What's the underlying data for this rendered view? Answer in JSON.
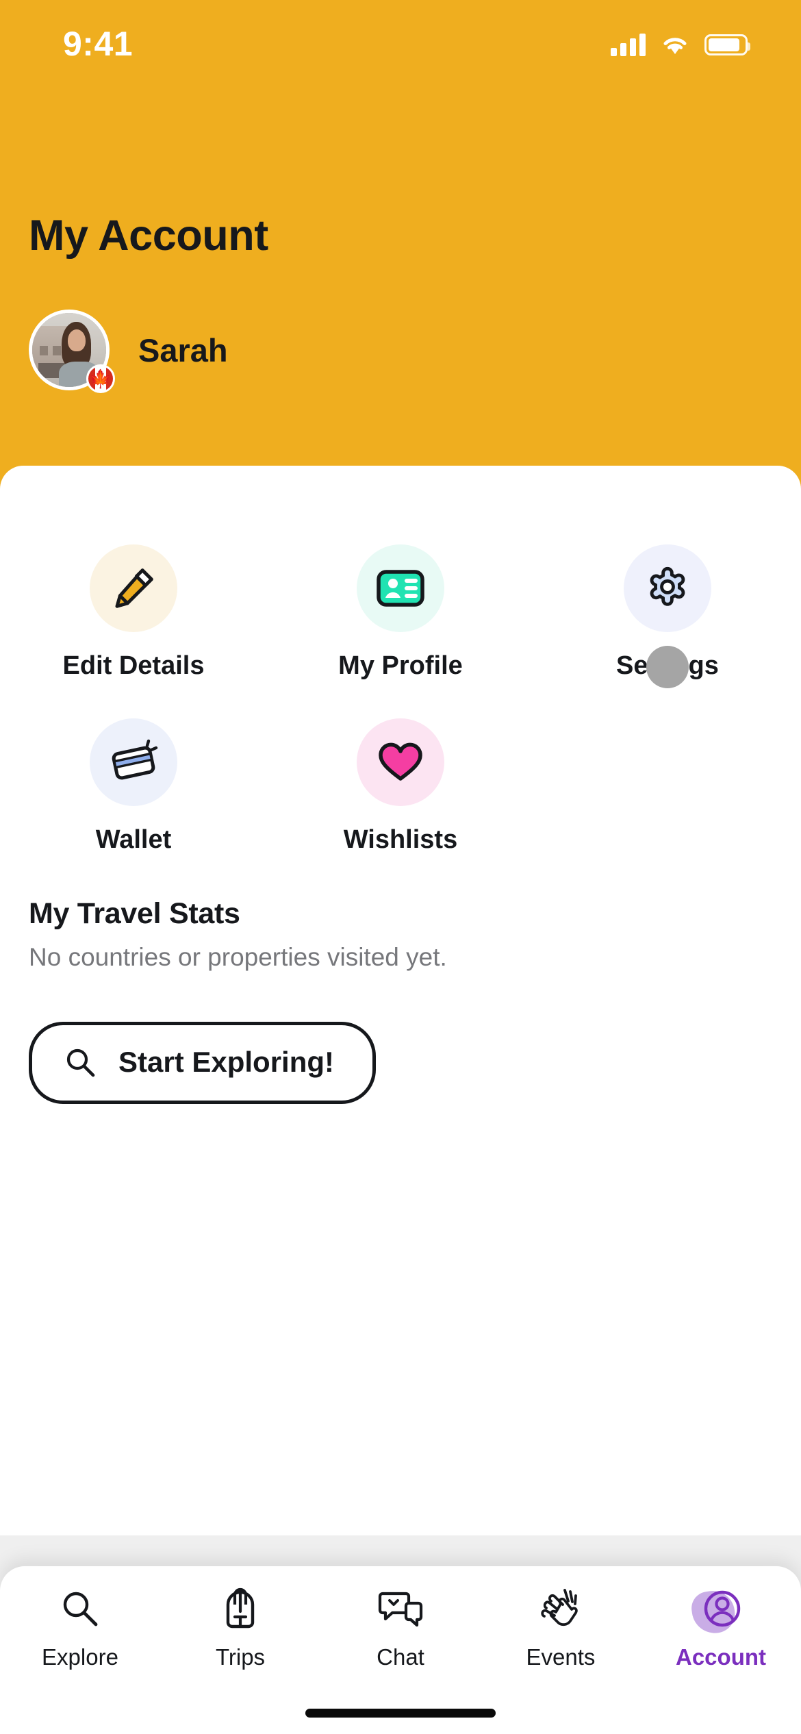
{
  "status_bar": {
    "time": "9:41",
    "signal_icon": "cellular-signal-icon",
    "wifi_icon": "wifi-icon",
    "battery_icon": "battery-icon"
  },
  "header": {
    "title": "My Account",
    "profile_name": "Sarah",
    "avatar_name": "user-avatar",
    "flag_badge": "canada-flag-badge",
    "background_color": "#EFAE1F",
    "title_color": "#16181C"
  },
  "shortcuts": [
    {
      "label": "Edit Details",
      "icon": "pencil-icon",
      "circle_color": "#FBF3E2",
      "accent": "#EFAE1F"
    },
    {
      "label": "My Profile",
      "icon": "id-card-icon",
      "circle_color": "#E8FAF5",
      "accent": "#20E3B2"
    },
    {
      "label": "Settings",
      "icon": "gear-icon",
      "circle_color": "#EFF1FC",
      "accent": "#CFDEF8"
    },
    {
      "label": "Wallet",
      "icon": "credit-card-icon",
      "circle_color": "#EDF1FB",
      "accent": "#8FAEEB"
    },
    {
      "label": "Wishlists",
      "icon": "heart-icon",
      "circle_color": "#FCE4F2",
      "accent": "#F53EA2"
    }
  ],
  "touch_indicator": {
    "name": "touch-point-indicator",
    "color": "#A5A5A5",
    "over": "Settings"
  },
  "travel_stats": {
    "title": "My Travel Stats",
    "empty_message": "No countries or properties visited yet.",
    "button_label": "Start Exploring!",
    "button_icon": "search-icon"
  },
  "bottom_nav": {
    "active": "Account",
    "active_color": "#7B2FBE",
    "items": [
      {
        "label": "Explore",
        "icon": "magnifier-icon",
        "active": false
      },
      {
        "label": "Trips",
        "icon": "backpack-icon",
        "active": false
      },
      {
        "label": "Chat",
        "icon": "chat-bubbles-icon",
        "active": false
      },
      {
        "label": "Events",
        "icon": "clapping-hands-icon",
        "active": false
      },
      {
        "label": "Account",
        "icon": "user-circle-icon",
        "active": true
      }
    ]
  }
}
